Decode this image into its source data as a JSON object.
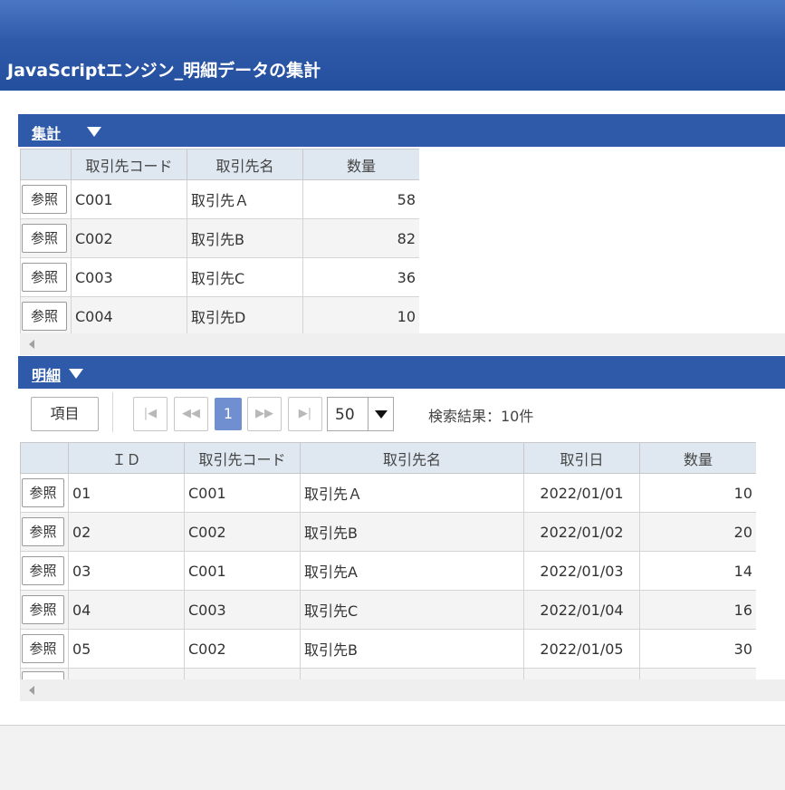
{
  "header": {
    "title": "JavaScriptエンジン_明細データの集計"
  },
  "summary": {
    "title": "集計",
    "columns": [
      "",
      "取引先コード",
      "取引先名",
      "数量"
    ],
    "button_label": "参照",
    "rows": [
      {
        "code": "C001",
        "name": "取引先Ａ",
        "qty": "58"
      },
      {
        "code": "C002",
        "name": "取引先B",
        "qty": "82"
      },
      {
        "code": "C003",
        "name": "取引先C",
        "qty": "36"
      },
      {
        "code": "C004",
        "name": "取引先D",
        "qty": "10"
      }
    ]
  },
  "detail": {
    "title": "明細",
    "item_button": "項目",
    "pager": {
      "first_icon": "first-page-icon",
      "prev_icon": "prev-page-icon",
      "current_page": "1",
      "next_icon": "next-page-icon",
      "last_icon": "last-page-icon",
      "page_size": "50"
    },
    "result_text": "検索結果：10件",
    "columns": [
      "",
      "ＩＤ",
      "取引先コード",
      "取引先名",
      "取引日",
      "数量"
    ],
    "button_label": "参照",
    "rows": [
      {
        "id": "01",
        "code": "C001",
        "name": "取引先Ａ",
        "date": "2022/01/01",
        "qty": "10"
      },
      {
        "id": "02",
        "code": "C002",
        "name": "取引先B",
        "date": "2022/01/02",
        "qty": "20"
      },
      {
        "id": "03",
        "code": "C001",
        "name": "取引先A",
        "date": "2022/01/03",
        "qty": "14"
      },
      {
        "id": "04",
        "code": "C003",
        "name": "取引先C",
        "date": "2022/01/04",
        "qty": "16"
      },
      {
        "id": "05",
        "code": "C002",
        "name": "取引先B",
        "date": "2022/01/05",
        "qty": "30"
      }
    ]
  }
}
